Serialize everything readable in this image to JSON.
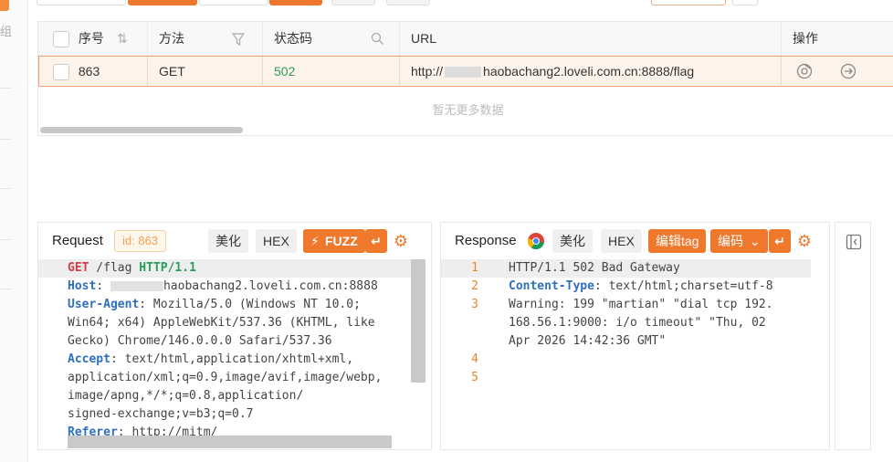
{
  "table": {
    "columns": [
      "序号",
      "方法",
      "状态码",
      "URL",
      "操作"
    ],
    "row": {
      "id": "863",
      "method": "GET",
      "status": "502",
      "url_prefix": "http://",
      "url_rest": "haobachang2.loveli.com.cn:8888/flag"
    },
    "empty_text": "暂无更多数据"
  },
  "left": {
    "group_char": "组"
  },
  "request": {
    "title": "Request",
    "id_tag": "id: 863",
    "beautify": "美化",
    "hex": "HEX",
    "fuzz": "FUZZ",
    "lines": [
      {
        "k": "GET",
        "rest": " /flag ",
        "k2": "HTTP/1.1"
      },
      {
        "k": "Host",
        "rest": ": ",
        "v": "haobachang2.loveli.com.cn:8888"
      },
      {
        "k": "User-Agent",
        "rest": ": Mozilla/5.0 (Windows NT 10.0;"
      },
      {
        "rest": "Win64; x64) AppleWebKit/537.36 (KHTML, like"
      },
      {
        "rest": "Gecko) Chrome/146.0.0.0 Safari/537.36"
      },
      {
        "k": "Accept",
        "rest": ": text/html,application/xhtml+xml,"
      },
      {
        "rest": "application/xml;q=0.9,image/avif,image/webp,"
      },
      {
        "rest": "image/apng,*/*;q=0.8,application/"
      },
      {
        "rest": "signed-exchange;v=b3;q=0.7"
      },
      {
        "k": "Referer",
        "rest": ": ",
        "v": "http://mitm/"
      }
    ]
  },
  "response": {
    "title": "Response",
    "beautify": "美化",
    "hex": "HEX",
    "edit_tag": "编辑tag",
    "encoding": "编码",
    "line_numbers": [
      "1",
      "2",
      "3",
      "4",
      "5"
    ],
    "lines": [
      {
        "rest": "HTTP/1.1 502 Bad Gateway"
      },
      {
        "k": "Content-Type",
        "rest": ": text/html;charset=utf-8"
      },
      {
        "rest": "Warning: 199 \"martian\" \"dial tcp 192."
      },
      {
        "rest": "168.56.1:9000: i/o timeout\" \"Thu, 02"
      },
      {
        "rest": "Apr 2026 14:42:36 GMT\""
      }
    ]
  },
  "colors": {
    "accent": "#f0782d",
    "status_ok": "#2a9d5b",
    "keyword": "#2f6fbf",
    "method": "#d73a49"
  }
}
